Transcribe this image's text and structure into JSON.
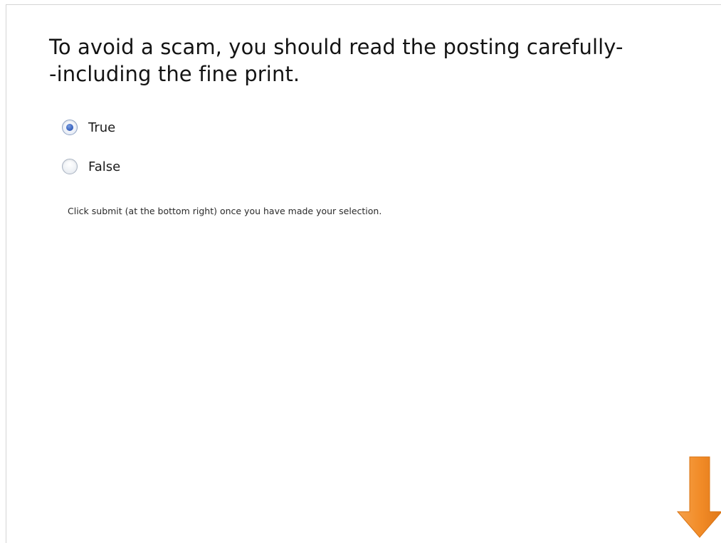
{
  "question": {
    "text": "To avoid a scam, you should read the posting carefully-\n-including the fine print."
  },
  "options": [
    {
      "label": "True",
      "selected": true
    },
    {
      "label": "False",
      "selected": false
    }
  ],
  "instruction": "Click submit (at the bottom right) once you have made your selection.",
  "arrow": {
    "icon": "arrow-down-icon",
    "color": "#f28c28"
  }
}
